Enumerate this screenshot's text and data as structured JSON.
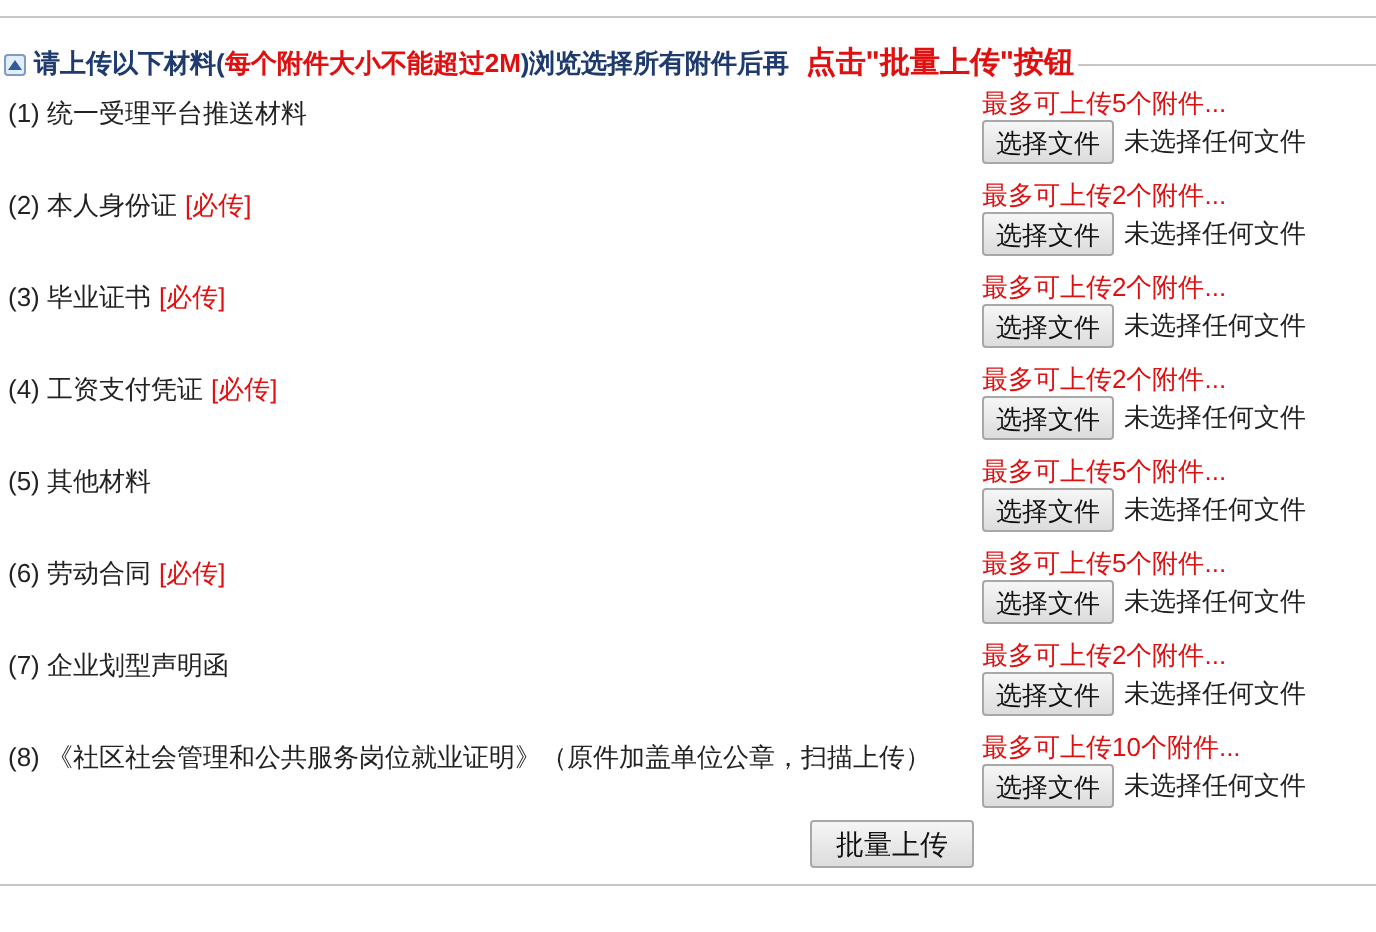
{
  "header": {
    "collapsed": false,
    "title_start": "请上传以下材料(",
    "title_note": "每个附件大小不能超过2M",
    "title_end": ")浏览选择所有附件后再",
    "instruction": "点击\"批量上传\"按钮"
  },
  "rows": [
    {
      "label": "(1) 统一受理平台推送材料",
      "limit": "最多可上传5个附件...",
      "button": "选择文件",
      "file_status": "未选择任何文件"
    },
    {
      "label": "(2) 本人身份证",
      "required": "[必传]",
      "limit": "最多可上传2个附件...",
      "button": "选择文件",
      "file_status": "未选择任何文件"
    },
    {
      "label": "(3) 毕业证书",
      "required": "[必传]",
      "limit": "最多可上传2个附件...",
      "button": "选择文件",
      "file_status": "未选择任何文件"
    },
    {
      "label": "(4) 工资支付凭证",
      "required": "[必传]",
      "limit": "最多可上传2个附件...",
      "button": "选择文件",
      "file_status": "未选择任何文件"
    },
    {
      "label": "(5) 其他材料",
      "limit": "最多可上传5个附件...",
      "button": "选择文件",
      "file_status": "未选择任何文件"
    },
    {
      "label": "(6) 劳动合同",
      "required": "[必传]",
      "limit": "最多可上传5个附件...",
      "button": "选择文件",
      "file_status": "未选择任何文件"
    },
    {
      "label": "(7) 企业划型声明函",
      "limit": "最多可上传2个附件...",
      "button": "选择文件",
      "file_status": "未选择任何文件"
    },
    {
      "label": "(8) 《社区社会管理和公共服务岗位就业证明》（原件加盖单位公章，扫描上传）",
      "limit": "最多可上传10个附件...",
      "button": "选择文件",
      "file_status": "未选择任何文件"
    }
  ],
  "submit": "批量上传"
}
